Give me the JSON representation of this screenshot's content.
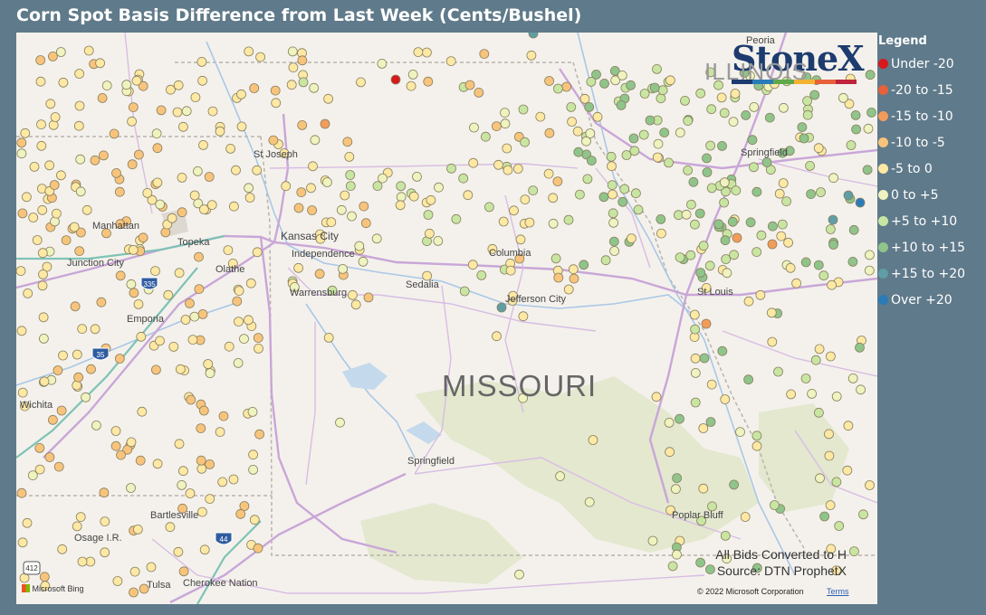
{
  "title": "Corn Spot Basis Difference from Last Week (Cents/Bushel)",
  "legend": {
    "title": "Legend",
    "items": [
      {
        "label": "Under -20",
        "color": "#d7191c"
      },
      {
        "label": "-20 to -15",
        "color": "#e8603a"
      },
      {
        "label": "-15 to -10",
        "color": "#f39c5a"
      },
      {
        "label": "-10 to -5",
        "color": "#f8c47c"
      },
      {
        "label": "-5 to 0",
        "color": "#fde8a4"
      },
      {
        "label": "0 to +5",
        "color": "#eef3bf"
      },
      {
        "label": "+5 to +10",
        "color": "#c8e6a2"
      },
      {
        "label": "+10 to +15",
        "color": "#8fc48a"
      },
      {
        "label": "+15 to +20",
        "color": "#5f9ea6"
      },
      {
        "label": "Over +20",
        "color": "#2b7bb9"
      }
    ]
  },
  "map": {
    "state_label": "MISSOURI",
    "cities": [
      "St Joseph",
      "Kansas City",
      "Independence",
      "Manhattan",
      "Topeka",
      "Junction City",
      "Olathe",
      "Emporia",
      "Wichita",
      "Warrensburg",
      "Sedalia",
      "Columbia",
      "Jefferson City",
      "St Louis",
      "Springfield",
      "Springfield",
      "Peoria",
      "Bartlesville",
      "Osage I.R.",
      "Tulsa",
      "Cherokee Nation",
      "Poplar Bluff"
    ],
    "state_abbrev": "ILLINOIS",
    "highways": [
      "335",
      "35",
      "44",
      "412"
    ],
    "notes": [
      "All Bids Converted to H",
      "Source: DTN ProphetX"
    ],
    "copyright": "© 2022 Microsoft Corporation",
    "terms": "Terms",
    "bing": "Microsoft Bing"
  },
  "logo": {
    "text": "StoneX",
    "bar_colors": [
      "#1d3b6e",
      "#2b7bb9",
      "#5fa84a",
      "#f2b233",
      "#e8603a",
      "#c0243b"
    ]
  }
}
